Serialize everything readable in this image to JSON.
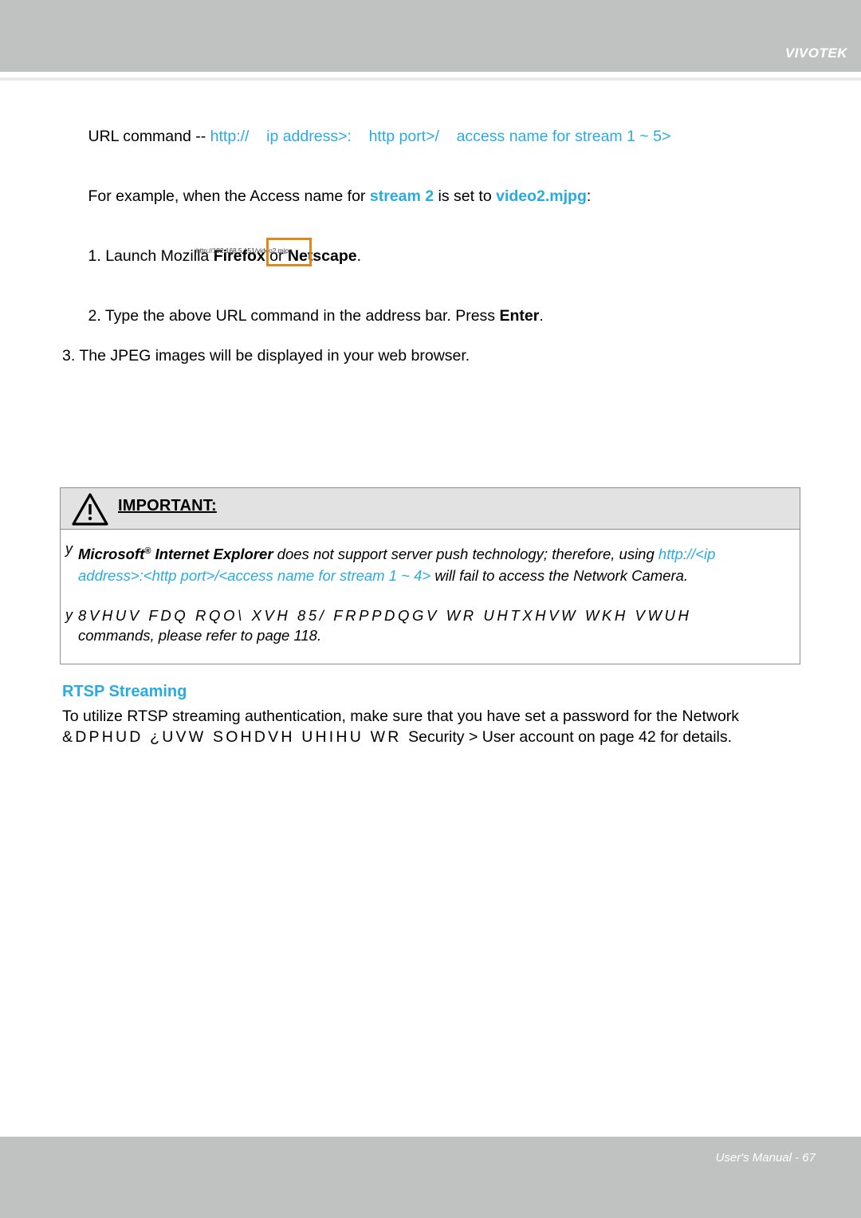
{
  "header": {
    "brand": "VIVOTEK"
  },
  "intro": {
    "url_command_label": "URL command -- ",
    "url_command_value": "http://    ip address>:    http port>/    access name for stream 1 ~ 5>",
    "example_prefix": "For example, when the Access name for ",
    "example_stream": "stream 2",
    "example_mid": " is set to ",
    "example_file": "video2.mjpg",
    "example_suffix": ":",
    "step1_prefix": "1. Launch Mozilla ",
    "step1_app1": "Firefox",
    "step1_mid": " or ",
    "step1_app2": "Netscape",
    "step1_suffix": ".",
    "step2_prefix": "2. Type the above URL command in the address bar. Press ",
    "step2_key": "Enter",
    "step2_suffix": ".",
    "step3": "3. The JPEG images will be displayed in your web browser."
  },
  "figure": {
    "address_bar_url": "http://192.168.5.151/video2.mjpg",
    "highlight_color": "#e0881c"
  },
  "important": {
    "title": "IMPORTANT:",
    "icon": "warning-triangle-icon",
    "bullet_mark": "y",
    "bullet1_b1": "Microsoft",
    "bullet1_sup": "®",
    "bullet1_b2": " Internet Explorer",
    "bullet1_t1": " does not support server push technology; therefore, using ",
    "bullet1_link1": "http://<ip",
    "bullet1_link2": "address>:<http port>/<access name for stream 1 ~ 4>",
    "bullet1_t2": " will fail to access the Network Camera.",
    "bullet2_garbled": "8VHUV FDQ RQO\\ XVH 85/ FRPPDQGV WR UHTXHVW WKH VWUH",
    "bullet2_tail": "commands, please refer to page 118."
  },
  "rtsp": {
    "title": "RTSP Streaming",
    "line1": "To utilize RTSP streaming authentication, make sure that you have set a password for the Network",
    "line2_garbled": "&DPHUD ¿UVW  SOHDVH UHIHU WR ",
    "line2_plain": "Security > User account on page 42 for details."
  },
  "footer": {
    "page_label": "User's Manual - 67"
  },
  "colors": {
    "accent_blue": "#29abe2",
    "band_gray": "#c0c2c2",
    "callout_head_gray": "#e2e2e2",
    "highlight_orange": "#e0881c"
  }
}
